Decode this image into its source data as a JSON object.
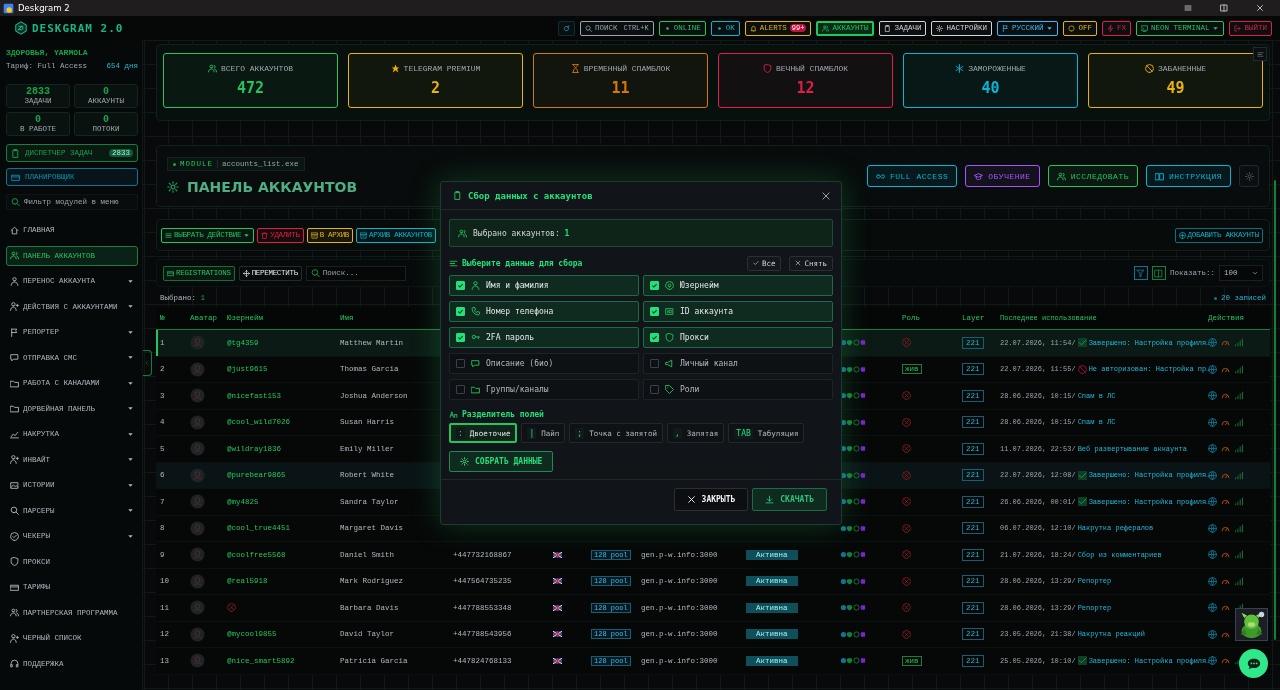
{
  "window": {
    "title": "Deskgram 2"
  },
  "header": {
    "logo": "DESKGRAM 2.0",
    "toolbar": [
      {
        "kind": "search",
        "label": "ПОИСК",
        "shortcut": "CTRL+K",
        "color": "#9ca3af",
        "selected": false
      },
      {
        "kind": "status",
        "label": "ONLINE",
        "color": "#22c55e",
        "selected": false
      },
      {
        "kind": "status",
        "label": "OK",
        "color": "#06b6d4",
        "selected": false
      },
      {
        "kind": "alerts",
        "label": "ALERTS",
        "badge": "99+",
        "color": "#eab308",
        "selected": false
      },
      {
        "kind": "accounts",
        "label": "АККАУНТЫ",
        "color": "#22c55e",
        "selected": true
      },
      {
        "kind": "tasks",
        "label": "ЗАДАЧИ",
        "color": "#d1d5db",
        "selected": false
      },
      {
        "kind": "settings",
        "label": "НАСТРОЙКИ",
        "color": "#d1d5db",
        "selected": false
      },
      {
        "kind": "language",
        "label": "РУССКИЙ",
        "color": "#38bdf8",
        "selected": false
      },
      {
        "kind": "toggle",
        "label": "OFF",
        "color": "#eab308",
        "selected": false
      },
      {
        "kind": "fx",
        "label": "FX",
        "color": "#e11d48",
        "selected": false
      },
      {
        "kind": "theme",
        "label": "NEON TERMINAL",
        "color": "#22c55e",
        "selected": false
      },
      {
        "kind": "logout",
        "label": "ВЫЙТИ",
        "color": "#e11d48",
        "selected": false
      }
    ]
  },
  "sidebar": {
    "greeting": "ЗДОРОВЬЯ, YARMOLA",
    "plan": "Тариф: Full Access",
    "days": "654 дня",
    "stats": [
      {
        "value": "2833",
        "label": "ЗАДАЧИ"
      },
      {
        "value": "0",
        "label": "АККАУНТЫ"
      },
      {
        "value": "0",
        "label": "В РАБОТЕ"
      },
      {
        "value": "0",
        "label": "ПОТОКИ"
      }
    ],
    "task_manager": {
      "label": "ДИСПЕТЧЕР ЗАДАЧ",
      "badge": "2833"
    },
    "scheduler": "ПЛАНИРОВЩИК",
    "filter": {
      "placeholder": "Фильтр модулей в меню"
    },
    "items": [
      {
        "label": "ГЛАВНАЯ",
        "selected": false,
        "expandable": false
      },
      {
        "label": "ПАНЕЛЬ АККАУНТОВ",
        "selected": true,
        "expandable": false
      },
      {
        "label": "ПЕРЕНОС АККАУНТА",
        "selected": false,
        "expandable": true
      },
      {
        "label": "ДЕЙСТВИЯ С АККАУНТАМИ",
        "selected": false,
        "expandable": true
      },
      {
        "label": "РЕПОРТЕР",
        "selected": false,
        "expandable": true
      },
      {
        "label": "ОТПРАВКА СМС",
        "selected": false,
        "expandable": true
      },
      {
        "label": "РАБОТА С КАНАЛАМИ",
        "selected": false,
        "expandable": true
      },
      {
        "label": "ДОРВЕЙНАЯ ПАНЕЛЬ",
        "selected": false,
        "expandable": true
      },
      {
        "label": "НАКРУТКА",
        "selected": false,
        "expandable": true
      },
      {
        "label": "ИНВАЙТ",
        "selected": false,
        "expandable": true
      },
      {
        "label": "ИСТОРИИ",
        "selected": false,
        "expandable": true
      },
      {
        "label": "ПАРСЕРЫ",
        "selected": false,
        "expandable": true
      },
      {
        "label": "ЧЕКЕРЫ",
        "selected": false,
        "expandable": true
      },
      {
        "label": "ПРОКСИ",
        "selected": false,
        "expandable": false
      },
      {
        "label": "ТАРИФЫ",
        "selected": false,
        "expandable": false
      },
      {
        "label": "ПАРТНЕРСКАЯ ПРОГРАММА",
        "selected": false,
        "expandable": false
      },
      {
        "label": "ЧЕРНЫЙ СПИСОК",
        "selected": false,
        "expandable": false
      },
      {
        "label": "ПОДДЕРЖКА",
        "selected": false,
        "expandable": false
      }
    ]
  },
  "stats": [
    {
      "label": "ВСЕГО АККАУНТОВ",
      "value": "472",
      "color": "#22c55e"
    },
    {
      "label": "TELEGRAM PREMIUM",
      "value": "2",
      "color": "#eab308"
    },
    {
      "label": "ВРЕМЕННЫЙ СПАМБЛОК",
      "value": "11",
      "color": "#d97706"
    },
    {
      "label": "ВЕЧНЫЙ СПАМБЛОК",
      "value": "12",
      "color": "#e11d48"
    },
    {
      "label": "ЗАМОРОЖЕННЫЕ",
      "value": "40",
      "color": "#06b6d4"
    },
    {
      "label": "ЗАБАНЕННЫЕ",
      "value": "49",
      "color": "#eab308"
    }
  ],
  "panel": {
    "module": "MODULE",
    "file": "accounts_list.exe",
    "title": "ПАНЕЛЬ АККАУНТОВ",
    "buttons": [
      {
        "label": "FULL ACCESS",
        "color": "#06b6d4"
      },
      {
        "label": "ОБУЧЕНИЕ",
        "color": "#a855f7"
      },
      {
        "label": "ИССЛЕДОВАТЬ",
        "color": "#22c55e"
      },
      {
        "label": "ИНСТРУКЦИЯ",
        "color": "#06b6d4"
      }
    ]
  },
  "actions": {
    "buttons": [
      {
        "label": "ВЫБРАТЬ ДЕЙСТВИЕ",
        "color": "#22c55e"
      },
      {
        "label": "УДАЛИТЬ",
        "color": "#e11d48"
      },
      {
        "label": "В АРХИВ",
        "color": "#eab308"
      },
      {
        "label": "АРХИВ АККАУНТОВ",
        "color": "#06b6d4"
      }
    ],
    "add": "ДОБАВИТЬ АККАУНТЫ"
  },
  "toolbar": {
    "registrations": "REGISTRATIONS",
    "move": "ПЕРЕМЕСТИТЬ",
    "search": {
      "placeholder": "Поиск..."
    },
    "show_label": "Показать::",
    "show_value": "100"
  },
  "selection": {
    "label": "Выбрано:",
    "count": "1",
    "records": "20 записей"
  },
  "table": {
    "columns": [
      "№",
      "Аватар",
      "Юзернейм",
      "Имя",
      "Роль",
      "Layer",
      "Последнее использование",
      "Действия"
    ],
    "rows": [
      {
        "num": "1",
        "username": "@tg4359",
        "name": "Matthew Martin",
        "layer": "221",
        "date": "22.07.2026, 11:54/",
        "result": {
          "kind": "done"
        },
        "task": "Завершено: Настройка профиля…",
        "selected": true,
        "highlighted": false
      },
      {
        "num": "2",
        "username": "@just9615",
        "name": "Thomas Garcia",
        "role": "жив",
        "layer": "221",
        "date": "22.07.2026, 11:55/",
        "result": {
          "kind": "unauthorized"
        },
        "task": "Не авторизован: Настройка пр…",
        "selected": false,
        "highlighted": false
      },
      {
        "num": "3",
        "username": "@nicefast153",
        "name": "Joshua Anderson",
        "layer": "221",
        "date": "28.06.2026, 10:15/",
        "task": "Спам в ЛС",
        "selected": false,
        "highlighted": false
      },
      {
        "num": "4",
        "username": "@cool_wild7026",
        "name": "Susan Harris",
        "layer": "221",
        "date": "28.06.2026, 10:15/",
        "task": "Спам в ЛС",
        "selected": false,
        "highlighted": false
      },
      {
        "num": "5",
        "username": "@wildray1836",
        "name": "Emily Miller",
        "layer": "221",
        "date": "11.07.2026, 22:53/",
        "task": "Веб развертывание аккаунта",
        "selected": false,
        "highlighted": false
      },
      {
        "num": "6",
        "username": "@purebear9865",
        "name": "Robert White",
        "layer": "221",
        "date": "22.07.2026, 12:08/",
        "result": {
          "kind": "done"
        },
        "task": "Завершено: Настройка профиля…",
        "selected": false,
        "highlighted": true
      },
      {
        "num": "7",
        "username": "@my4825",
        "name": "Sandra Taylor",
        "layer": "221",
        "date": "26.06.2026, 00:01/",
        "result": {
          "kind": "done"
        },
        "task": "Завершено: Настройка профиля…",
        "selected": false,
        "highlighted": false
      },
      {
        "num": "8",
        "username": "@cool_true4451",
        "name": "Margaret Davis",
        "layer": "221",
        "date": "06.07.2026, 12:10/",
        "task": "Накрутка рефералов",
        "selected": false,
        "highlighted": false
      },
      {
        "num": "9",
        "username": "@coolfree5568",
        "name": "Daniel Smith",
        "phone": "+447732168867",
        "pool": "128 pool",
        "proxy": "gen.p-w.info:3000",
        "state": "Активна",
        "layer": "221",
        "date": "21.07.2026, 18:24/",
        "task": "Сбор из комментариев",
        "selected": false,
        "highlighted": false
      },
      {
        "num": "10",
        "username": "@real5918",
        "name": "Mark Rodriguez",
        "phone": "+447564735235",
        "pool": "128 pool",
        "proxy": "gen.p-w.info:3000",
        "state": "Активна",
        "layer": "221",
        "date": "28.06.2026, 13:29/",
        "task": "Репортер",
        "selected": false,
        "highlighted": false
      },
      {
        "num": "11",
        "name": "Barbara Davis",
        "phone": "+447788553348",
        "pool": "128 pool",
        "proxy": "gen.p-w.info:3000",
        "state": "Активна",
        "layer": "221",
        "date": "28.06.2026, 13:29/",
        "task": "Репортер",
        "selected": false,
        "highlighted": false
      },
      {
        "num": "12",
        "username": "@mycool9855",
        "name": "David Taylor",
        "phone": "+447788543956",
        "pool": "128 pool",
        "proxy": "gen.p-w.info:3000",
        "state": "Активна",
        "layer": "221",
        "date": "23.05.2026, 21:38/",
        "task": "Накрутка реакций",
        "selected": false,
        "highlighted": false
      },
      {
        "num": "13",
        "username": "@nice_smart5892",
        "name": "Patricia Garcia",
        "phone": "+447824768133",
        "pool": "128 pool",
        "proxy": "gen.p-w.info:3000",
        "state": "Активна",
        "role": "жив",
        "layer": "221",
        "date": "25.05.2026, 10:10/",
        "result": {
          "kind": "done"
        },
        "task": "Завершено: Настройка профиля…",
        "selected": false,
        "highlighted": false
      }
    ]
  },
  "modal": {
    "title": "Сбор данных с аккаунтов",
    "selected_label": "Выбрано аккаунтов:",
    "selected_count": "1",
    "fields_title": "Выберите данные для сбора",
    "select_all": "Все",
    "clear": "Снять",
    "fields": [
      {
        "label": "Имя и фамилия",
        "checked": true
      },
      {
        "label": "Юзернейм",
        "checked": true
      },
      {
        "label": "Номер телефона",
        "checked": true
      },
      {
        "label": "ID аккаунта",
        "checked": true
      },
      {
        "label": "2FA пароль",
        "checked": true
      },
      {
        "label": "Прокси",
        "checked": true
      },
      {
        "label": "Описание (био)",
        "checked": false
      },
      {
        "label": "Личный канал",
        "checked": false
      },
      {
        "label": "Группы/каналы",
        "checked": false
      },
      {
        "label": "Роли",
        "checked": false
      }
    ],
    "separator_title": "Разделитель полей",
    "separators": [
      {
        "symbol": ":",
        "label": "Двоеточие",
        "selected": true
      },
      {
        "symbol": "|",
        "label": "Пайп",
        "selected": false
      },
      {
        "symbol": ";",
        "label": "Точка с запятой",
        "selected": false
      },
      {
        "symbol": ",",
        "label": "Запятая",
        "selected": false
      },
      {
        "symbol": "TAB",
        "label": "Табуляция",
        "selected": false
      }
    ],
    "collect": "СОБРАТЬ ДАННЫЕ",
    "close": "ЗАКРЫТЬ",
    "download": "СКАЧАТЬ"
  }
}
